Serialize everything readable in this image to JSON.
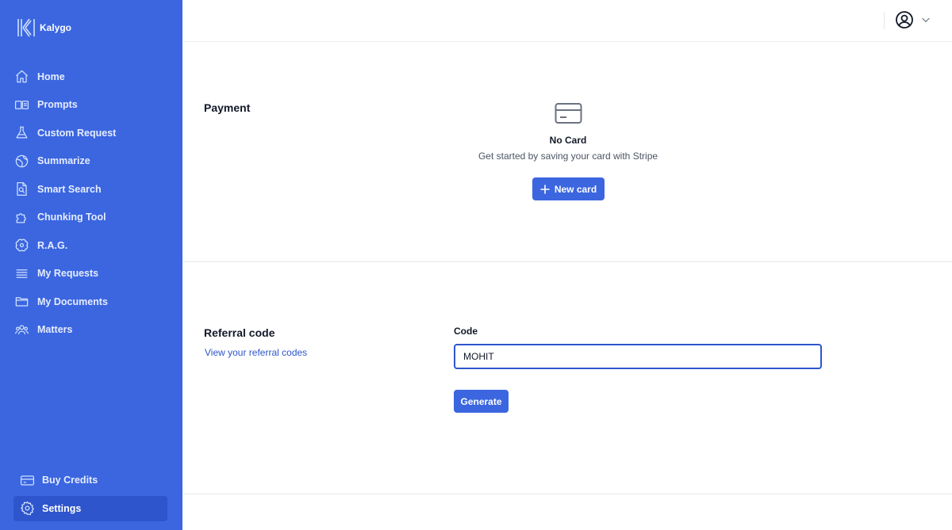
{
  "app": {
    "name": "Kalygo"
  },
  "sidebar": {
    "items": [
      {
        "label": "Home",
        "icon": "home-icon"
      },
      {
        "label": "Prompts",
        "icon": "prompts-icon"
      },
      {
        "label": "Custom Request",
        "icon": "beaker-icon"
      },
      {
        "label": "Summarize",
        "icon": "globe-icon"
      },
      {
        "label": "Smart Search",
        "icon": "document-search-icon"
      },
      {
        "label": "Chunking Tool",
        "icon": "puzzle-icon"
      },
      {
        "label": "R.A.G.",
        "icon": "brain-icon"
      },
      {
        "label": "My Requests",
        "icon": "list-icon"
      },
      {
        "label": "My Documents",
        "icon": "folder-icon"
      },
      {
        "label": "Matters",
        "icon": "users-icon"
      }
    ],
    "bottom": [
      {
        "label": "Buy Credits",
        "icon": "credit-card-icon"
      },
      {
        "label": "Settings",
        "icon": "gear-icon",
        "active": true
      }
    ]
  },
  "header": {
    "user_icon": "user-circle-icon",
    "menu_icon": "chevron-down-icon"
  },
  "payment": {
    "title": "Payment",
    "empty_title": "No Card",
    "empty_subtitle": "Get started by saving your card with Stripe",
    "new_card_label": "New card"
  },
  "referral": {
    "title": "Referral code",
    "link_label": "View your referral codes",
    "code_label": "Code",
    "code_value": "MOHIT",
    "generate_label": "Generate"
  },
  "colors": {
    "sidebar": "#3b66e0",
    "accent": "#3b66e0",
    "active": "#2e55cc"
  }
}
